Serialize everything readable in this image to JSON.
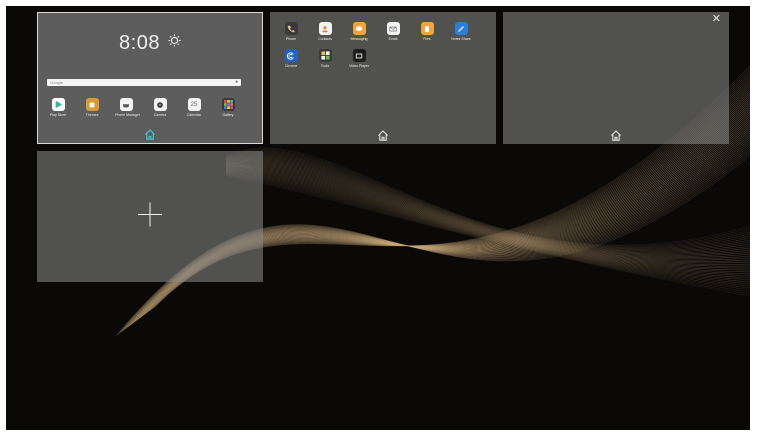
{
  "clock": {
    "time": "8:08"
  },
  "search": {
    "placeholder": "Google"
  },
  "screen1": {
    "apps": [
      {
        "label": "Play Store",
        "icon": "play-store-icon"
      },
      {
        "label": "Themes",
        "icon": "themes-icon"
      },
      {
        "label": "Phone Manager",
        "icon": "phone-manager-icon"
      },
      {
        "label": "Camera",
        "icon": "camera-icon"
      },
      {
        "label": "Calendar",
        "icon": "calendar-icon",
        "value": "25"
      },
      {
        "label": "Gallery",
        "icon": "gallery-icon"
      }
    ]
  },
  "screen2": {
    "apps": [
      {
        "label": "Phone",
        "icon": "phone-icon"
      },
      {
        "label": "Contacts",
        "icon": "contacts-icon"
      },
      {
        "label": "Messaging",
        "icon": "messaging-icon"
      },
      {
        "label": "Email",
        "icon": "email-icon"
      },
      {
        "label": "Files",
        "icon": "files-icon"
      },
      {
        "label": "Notes Share",
        "icon": "notes-share-icon"
      },
      {
        "label": "Chrome",
        "icon": "browser-icon"
      },
      {
        "label": "Tools",
        "icon": "tools-icon"
      },
      {
        "label": "Video Player",
        "icon": "video-player-icon"
      }
    ]
  },
  "colors": {
    "home_active": "#3fc7cf",
    "home_inactive": "#e0e0e0",
    "background": "#0b0908",
    "wave": "#c8a97a"
  }
}
